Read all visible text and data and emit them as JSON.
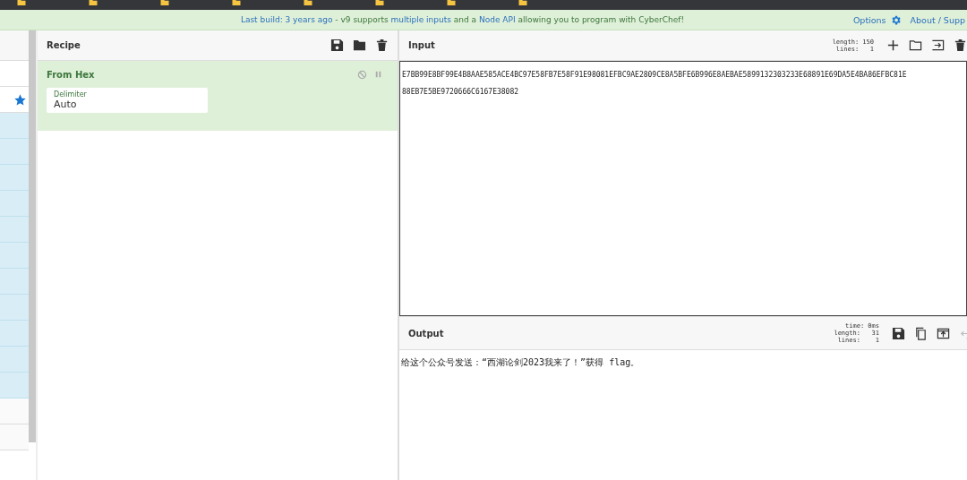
{
  "banner": {
    "parts": [
      {
        "text": "Last build: 3 years ago",
        "link": true
      },
      {
        "text": " - ",
        "link": false
      },
      {
        "text": "v9 supports ",
        "link": false
      },
      {
        "text": "multiple inputs",
        "link": true
      },
      {
        "text": " and a ",
        "link": false
      },
      {
        "text": "Node API",
        "link": true
      },
      {
        "text": " allowing you to program with CyberChef!",
        "link": false
      }
    ],
    "options": "Options",
    "about": "About / Supp"
  },
  "operations": {
    "favourite_starred": true
  },
  "recipe": {
    "title": "Recipe",
    "operation": {
      "name": "From Hex",
      "disabled": false,
      "paused": false,
      "arg_label": "Delimiter",
      "arg_value": "Auto"
    }
  },
  "input": {
    "title": "Input",
    "length_label": "length:",
    "length": "150",
    "lines_label": "lines:",
    "lines": "1",
    "text": "E7BB99E8BF99E4B8AAE585ACE4BC97E58FB7E58F91E98081EFBC9AE2809CE8A5BFE6B996E8AEBAE5899132303233E68891E69DA5E4BA86EFBC81E\n88EB7E5BE9720666C6167E38082"
  },
  "output": {
    "title": "Output",
    "time_label": "time:",
    "time": "0ms",
    "length_label": "length:",
    "length": "31",
    "lines_label": "lines:",
    "lines": "1",
    "text": "给这个公众号发送：“西湖论剑2023我来了！”获得 flag。"
  }
}
